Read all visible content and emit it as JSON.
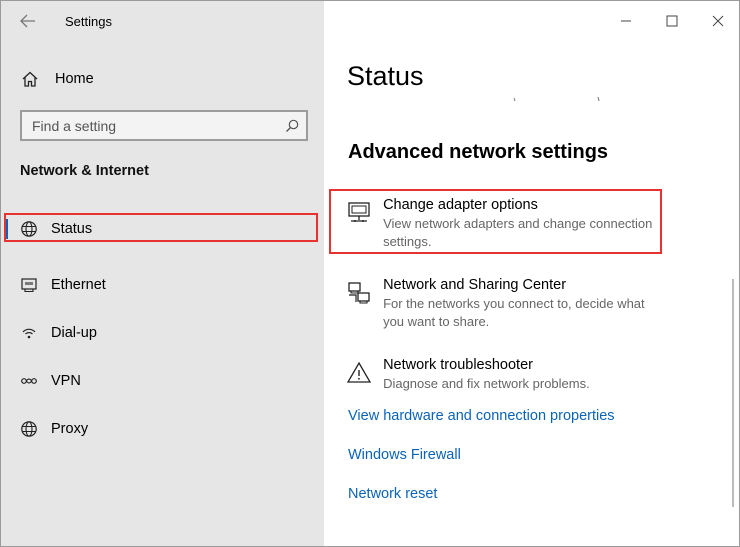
{
  "window": {
    "app_title": "Settings",
    "controls": [
      "minimize",
      "maximize",
      "close"
    ]
  },
  "sidebar": {
    "home_label": "Home",
    "search_placeholder": "Find a setting",
    "section_title": "Network & Internet",
    "items": [
      {
        "label": "Status",
        "icon": "globe-icon",
        "active": true
      },
      {
        "label": "Ethernet",
        "icon": "ethernet-icon",
        "active": false
      },
      {
        "label": "Dial-up",
        "icon": "dialup-icon",
        "active": false
      },
      {
        "label": "VPN",
        "icon": "vpn-icon",
        "active": false
      },
      {
        "label": "Proxy",
        "icon": "globe-icon",
        "active": false
      }
    ]
  },
  "main": {
    "page_title": "Status",
    "advanced_heading": "Advanced network settings",
    "options": [
      {
        "title": "Change adapter options",
        "description": "View network adapters and change connection settings.",
        "icon": "adapter-monitor-icon"
      },
      {
        "title": "Network and Sharing Center",
        "description": "For the networks you connect to, decide what you want to share.",
        "icon": "sharing-center-icon"
      },
      {
        "title": "Network troubleshooter",
        "description": "Diagnose and fix network problems.",
        "icon": "warning-icon"
      }
    ],
    "links": [
      "View hardware and connection properties",
      "Windows Firewall",
      "Network reset"
    ]
  },
  "colors": {
    "accent": "#0067c0",
    "link": "#0b63b8",
    "highlight": "#e8322f",
    "sidebar_bg": "#e6e6e6"
  }
}
